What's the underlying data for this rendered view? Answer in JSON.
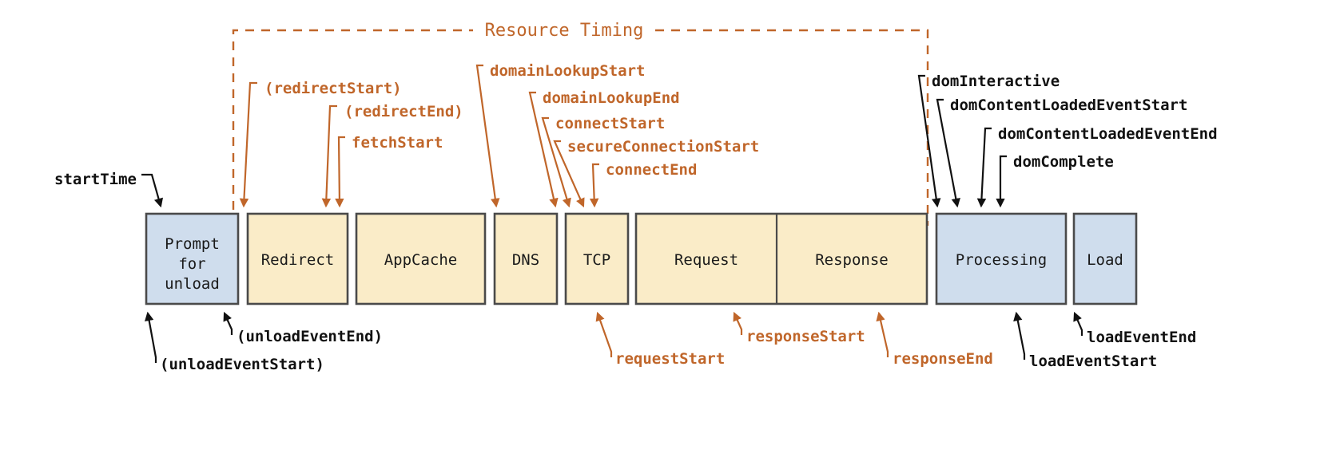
{
  "diagram": {
    "title": "Resource Timing",
    "colors": {
      "orange": "#c0662a",
      "black": "#111111",
      "box_yellow_fill": "#faecc8",
      "box_blue_fill": "#cfdded",
      "box_stroke": "#4a4a4a"
    },
    "phases": [
      {
        "id": "prompt-for-unload",
        "label_lines": [
          "Prompt",
          "for",
          "unload"
        ],
        "fill": "blue"
      },
      {
        "id": "redirect",
        "label_lines": [
          "Redirect"
        ],
        "fill": "yellow"
      },
      {
        "id": "appcache",
        "label_lines": [
          "AppCache"
        ],
        "fill": "yellow"
      },
      {
        "id": "dns",
        "label_lines": [
          "DNS"
        ],
        "fill": "yellow"
      },
      {
        "id": "tcp",
        "label_lines": [
          "TCP"
        ],
        "fill": "yellow"
      },
      {
        "id": "request",
        "label_lines": [
          "Request"
        ],
        "fill": "yellow"
      },
      {
        "id": "response",
        "label_lines": [
          "Response"
        ],
        "fill": "yellow"
      },
      {
        "id": "processing",
        "label_lines": [
          "Processing"
        ],
        "fill": "blue"
      },
      {
        "id": "load",
        "label_lines": [
          "Load"
        ],
        "fill": "blue"
      }
    ],
    "annotations_top": [
      {
        "id": "start-time",
        "label": "startTime",
        "color": "black"
      },
      {
        "id": "redirect-start",
        "label": "(redirectStart)",
        "color": "orange"
      },
      {
        "id": "redirect-end",
        "label": "(redirectEnd)",
        "color": "orange"
      },
      {
        "id": "fetch-start",
        "label": "fetchStart",
        "color": "orange"
      },
      {
        "id": "domain-lookup-start",
        "label": "domainLookupStart",
        "color": "orange"
      },
      {
        "id": "domain-lookup-end",
        "label": "domainLookupEnd",
        "color": "orange"
      },
      {
        "id": "connect-start",
        "label": "connectStart",
        "color": "orange"
      },
      {
        "id": "secure-connection-start",
        "label": "secureConnectionStart",
        "color": "orange"
      },
      {
        "id": "connect-end",
        "label": "connectEnd",
        "color": "orange"
      },
      {
        "id": "dom-interactive",
        "label": "domInteractive",
        "color": "black"
      },
      {
        "id": "dom-content-loaded-event-start",
        "label": "domContentLoadedEventStart",
        "color": "black"
      },
      {
        "id": "dom-content-loaded-event-end",
        "label": "domContentLoadedEventEnd",
        "color": "black"
      },
      {
        "id": "dom-complete",
        "label": "domComplete",
        "color": "black"
      }
    ],
    "annotations_bottom": [
      {
        "id": "unload-event-start",
        "label": "(unloadEventStart)",
        "color": "black"
      },
      {
        "id": "unload-event-end",
        "label": "(unloadEventEnd)",
        "color": "black"
      },
      {
        "id": "request-start",
        "label": "requestStart",
        "color": "orange"
      },
      {
        "id": "response-start",
        "label": "responseStart",
        "color": "orange"
      },
      {
        "id": "response-end",
        "label": "responseEnd",
        "color": "orange"
      },
      {
        "id": "load-event-start",
        "label": "loadEventStart",
        "color": "black"
      },
      {
        "id": "load-event-end",
        "label": "loadEventEnd",
        "color": "black"
      }
    ]
  }
}
